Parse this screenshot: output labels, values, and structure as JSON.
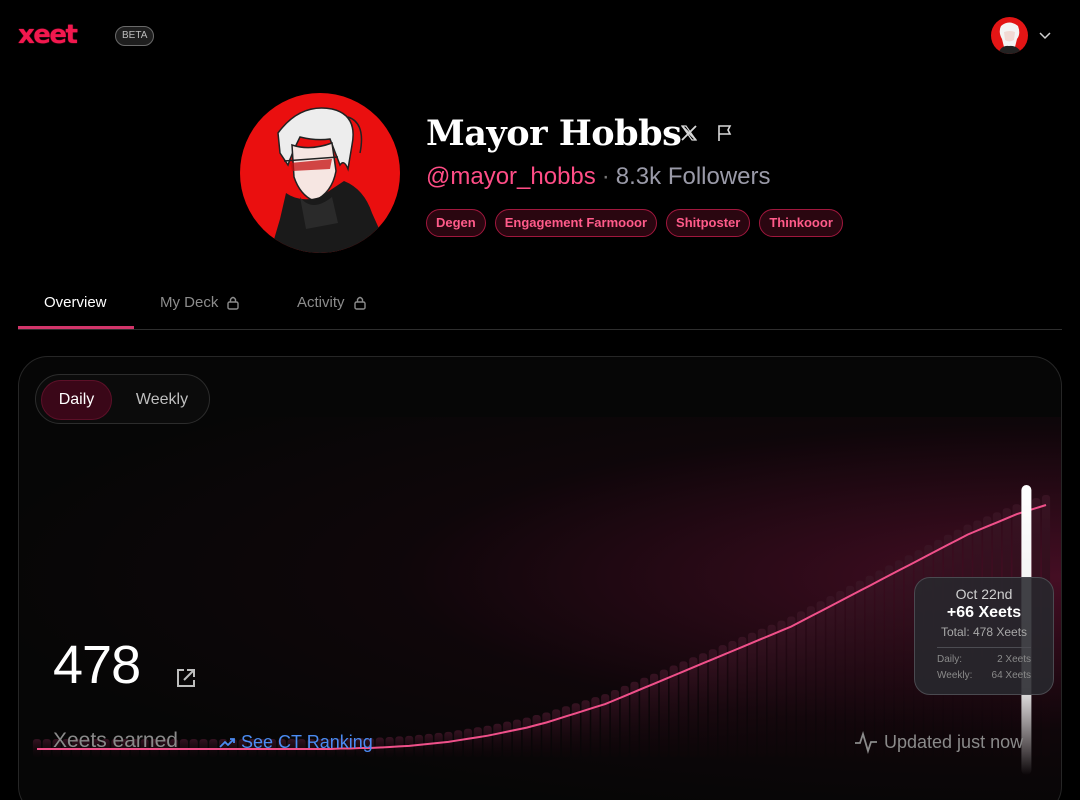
{
  "app": {
    "logo_text": "xeet",
    "beta_label": "BETA"
  },
  "user_menu": {
    "avatar": "user-avatar",
    "chevron": "chevron-down-icon"
  },
  "profile": {
    "name": "Mayor Hobbs",
    "handle": "@mayor_hobbs",
    "separator": "·",
    "followers": "8.3k Followers",
    "tags": [
      "Degen",
      "Engagement Farmooor",
      "Shitposter",
      "Thinkooor"
    ]
  },
  "tabs": [
    {
      "label": "Overview",
      "locked": false,
      "active": true
    },
    {
      "label": "My Deck",
      "locked": true,
      "active": false
    },
    {
      "label": "Activity",
      "locked": true,
      "active": false
    }
  ],
  "card": {
    "toggle": {
      "daily": "Daily",
      "weekly": "Weekly",
      "selected": "Daily"
    },
    "total_value": "478",
    "earned_label": "Xeets earned",
    "ranking_link": "See CT Ranking",
    "updated": "Updated just now",
    "tooltip": {
      "date": "Oct 22nd",
      "gain": "+66 Xeets",
      "total": "Total: 478 Xeets",
      "daily_label": "Daily:",
      "daily_value": "2 Xeets",
      "weekly_label": "Weekly:",
      "weekly_value": "64 Xeets"
    }
  },
  "colors": {
    "accent": "#ff4d86",
    "line": "#f0508a",
    "link": "#4b8bf2",
    "avatar_bg": "#ea0f0f"
  },
  "chart_data": {
    "type": "area",
    "series": [
      {
        "values": [
          0,
          0,
          0,
          0,
          0,
          0,
          0,
          0,
          0,
          0,
          0,
          0,
          0,
          0,
          0,
          0,
          0,
          0,
          0,
          0,
          0,
          0,
          0,
          0,
          0,
          0,
          0,
          0,
          0,
          0,
          0,
          1,
          1,
          2,
          2,
          3,
          4,
          5,
          6,
          8,
          10,
          12,
          14,
          17,
          20,
          23,
          26,
          30,
          34,
          38,
          42,
          47,
          52,
          58,
          64,
          70,
          76,
          82,
          88,
          96,
          104,
          112,
          120,
          128,
          136,
          144,
          152,
          160,
          168,
          176,
          184,
          192,
          200,
          208,
          216,
          224,
          232,
          240,
          250,
          260,
          270,
          280,
          290,
          300,
          310,
          320,
          330,
          340,
          350,
          360,
          370,
          380,
          390,
          400,
          410,
          420,
          428,
          436,
          444,
          452,
          460,
          466,
          472,
          478
        ]
      }
    ],
    "highlight": {
      "label": "Oct 22nd",
      "value": 478
    }
  }
}
